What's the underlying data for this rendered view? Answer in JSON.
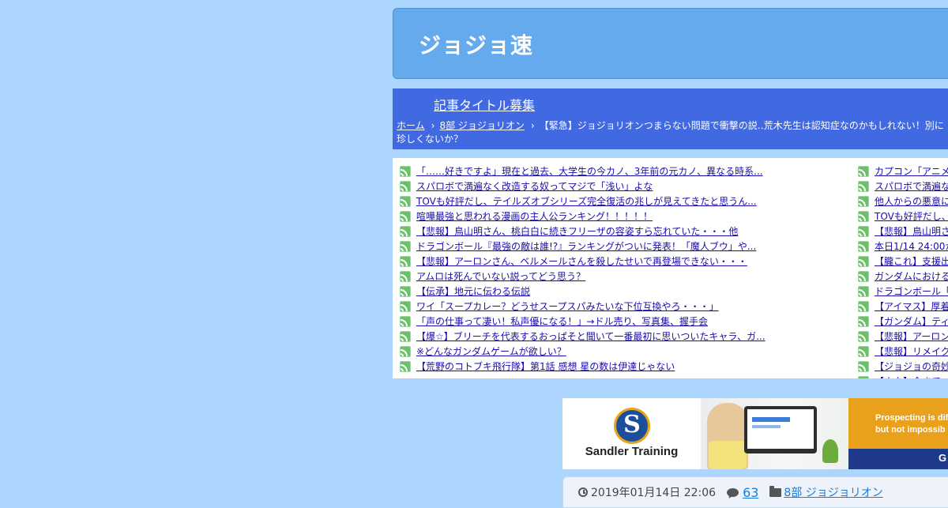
{
  "site": {
    "title": "ジョジョ速"
  },
  "nav": {
    "item": "記事タイトル募集"
  },
  "breadcrumb": {
    "home": "ホーム",
    "separator": "›",
    "category": "8部 ジョジョリオン",
    "current": "【緊急】ジョジョリオンつまらない問題で衝撃の説‥荒木先生は認知症なのかもしれない！別に珍しくないか？"
  },
  "rss_left": [
    "「……好きですよ」現在と過去、大学生の今カノ、3年前の元カノ、異なる時系...",
    "スパロボで満遍なく改造する奴ってマジで「浅い」よな",
    "TOVも好評だし、テイルズオブシリーズ完全復活の兆しが見えてきたと思うん...",
    "喧嘩最強と思われる漫画の主人公ランキング！！！！！",
    "【悲報】鳥山明さん、桃白白に続きフリーザの容姿すら忘れていた・・・他",
    "ドラゴンボール『最強の敵は誰!?』ランキングがついに発表！「魔人ブウ」や...",
    "【悲報】アーロンさん、ベルメールさんを殺したせいで再登場できない・・・",
    "アムロは死んでいない説ってどう思う？",
    "【伝承】地元に伝わる伝説",
    "ワイ「スープカレー？どうせスープスパみたいな下位互換やろ・・・」",
    "「声の仕事って凄い！私声優になる！」→ドル売り、写真集、握手会",
    "【爆☆】ブリーチを代表するおっぱそと聞いて一番最初に思いついたキャラ、ガ...",
    "※どんなガンダムゲームが欲しい？",
    "【荒野のコトブキ飛行隊】第1話 感想 星の数は伊達じゃない"
  ],
  "rss_right": [
    "カプコン「アニメ",
    "スパロボで満遍な",
    "他人からの悪意に",
    "TOVも好評だし、",
    "【悲報】鳥山明さ",
    "本日1/14 24:00か",
    "【朧これ】支援出",
    "ガンダムにおける",
    "ドラゴンボール「",
    "【アイマス】厚着",
    "【ガンダム】ティ",
    "【悲報】アーロン",
    "【悲報】リメイク",
    "【ジョジョの奇妙",
    "【ネタ】今まで"
  ],
  "ad": {
    "brand": "Sandler Training",
    "logo_letter": "S",
    "cta_line1": "Prospecting is diff",
    "cta_line2": "but not impossib",
    "cta_button": "G"
  },
  "meta": {
    "date": "2019年01月14日 22:06",
    "comments": "63",
    "category": "8部 ジョジョリオン"
  },
  "colors": {
    "background": "#acd6fe",
    "header": "#66aaee",
    "nav": "#4169e1",
    "link": "#1a0dab",
    "rss_icon": "#6cc06c"
  }
}
